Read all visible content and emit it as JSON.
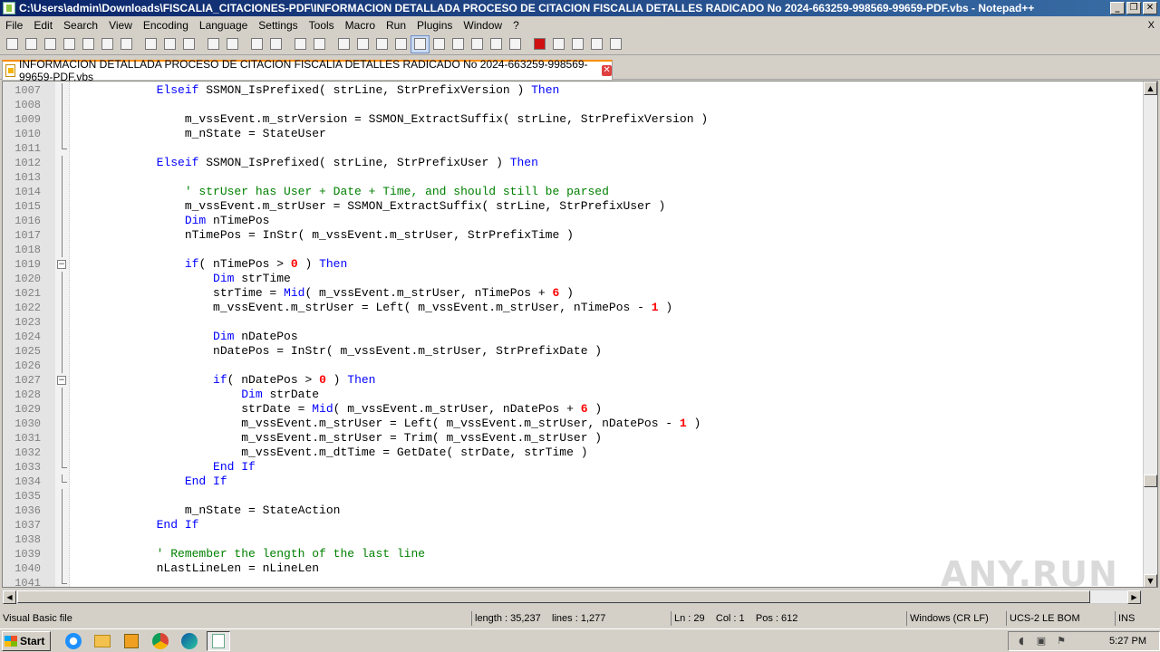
{
  "window": {
    "title": "C:\\Users\\admin\\Downloads\\FISCALIA_CITACIONES-PDF\\INFORMACION DETALLADA PROCESO DE CITACION FISCALIA DETALLES RADICADO No 2024-663259-998569-99659-PDF.vbs - Notepad++",
    "buttons": [
      "_",
      "❐",
      "✕"
    ]
  },
  "menu": {
    "items": [
      "File",
      "Edit",
      "Search",
      "View",
      "Encoding",
      "Language",
      "Settings",
      "Tools",
      "Macro",
      "Run",
      "Plugins",
      "Window",
      "?"
    ],
    "close_label": "X"
  },
  "toolbar": {
    "icons": [
      "new-file-icon",
      "open-file-icon",
      "save-icon",
      "save-all-icon",
      "close-icon",
      "close-all-icon",
      "print-icon",
      "sep",
      "cut-icon",
      "copy-icon",
      "paste-icon",
      "sep",
      "undo-icon",
      "redo-icon",
      "sep",
      "find-icon",
      "replace-icon",
      "sep",
      "zoom-in-icon",
      "zoom-out-icon",
      "sep",
      "sync-v-icon",
      "sync-h-icon",
      "word-wrap-icon",
      "show-all-chars-icon",
      "indent-guide-icon",
      "lang-icon",
      "doc-map-icon",
      "func-list-icon",
      "folder-workspace-icon",
      "monitor-icon",
      "sep",
      "record-macro-icon",
      "stop-record-icon",
      "play-macro-icon",
      "play-multiple-icon",
      "save-macro-icon"
    ]
  },
  "tab": {
    "label": "INFORMACION DETALLADA PROCESO DE CITACION FISCALIA DETALLES RADICADO No 2024-663259-998569-99659-PDF.vbs",
    "close": "✕"
  },
  "code_lines": [
    {
      "n": "1007",
      "fold": "line",
      "segs": [
        [
          "tx",
          "            "
        ],
        [
          "kw",
          "Elseif"
        ],
        [
          "tx",
          " SSMON_IsPrefixed( strLine, StrPrefixVersion ) "
        ],
        [
          "kw",
          "Then"
        ]
      ]
    },
    {
      "n": "1008",
      "fold": "line",
      "segs": []
    },
    {
      "n": "1009",
      "fold": "line",
      "segs": [
        [
          "tx",
          "                m_vssEvent.m_strVersion = SSMON_ExtractSuffix( strLine, StrPrefixVersion )"
        ]
      ]
    },
    {
      "n": "1010",
      "fold": "line",
      "segs": [
        [
          "tx",
          "                m_nState = StateUser"
        ]
      ]
    },
    {
      "n": "1011",
      "fold": "end",
      "segs": []
    },
    {
      "n": "1012",
      "fold": "line",
      "segs": [
        [
          "tx",
          "            "
        ],
        [
          "kw",
          "Elseif"
        ],
        [
          "tx",
          " SSMON_IsPrefixed( strLine, StrPrefixUser ) "
        ],
        [
          "kw",
          "Then"
        ]
      ]
    },
    {
      "n": "1013",
      "fold": "line",
      "segs": []
    },
    {
      "n": "1014",
      "fold": "line",
      "segs": [
        [
          "cm",
          "                ' strUser has User + Date + Time, and should still be parsed"
        ]
      ]
    },
    {
      "n": "1015",
      "fold": "line",
      "segs": [
        [
          "tx",
          "                m_vssEvent.m_strUser = SSMON_ExtractSuffix( strLine, StrPrefixUser )"
        ]
      ]
    },
    {
      "n": "1016",
      "fold": "line",
      "segs": [
        [
          "tx",
          "                "
        ],
        [
          "kw",
          "Dim"
        ],
        [
          "tx",
          " nTimePos"
        ]
      ]
    },
    {
      "n": "1017",
      "fold": "line",
      "segs": [
        [
          "tx",
          "                nTimePos = InStr( m_vssEvent.m_strUser, StrPrefixTime )"
        ]
      ]
    },
    {
      "n": "1018",
      "fold": "line",
      "segs": []
    },
    {
      "n": "1019",
      "fold": "box",
      "segs": [
        [
          "tx",
          "                "
        ],
        [
          "kw",
          "if"
        ],
        [
          "tx",
          "( nTimePos > "
        ],
        [
          "nm",
          "0"
        ],
        [
          "tx",
          " ) "
        ],
        [
          "kw",
          "Then"
        ]
      ]
    },
    {
      "n": "1020",
      "fold": "line",
      "segs": [
        [
          "tx",
          "                    "
        ],
        [
          "kw",
          "Dim"
        ],
        [
          "tx",
          " strTime"
        ]
      ]
    },
    {
      "n": "1021",
      "fold": "line",
      "segs": [
        [
          "tx",
          "                    strTime = "
        ],
        [
          "kw",
          "Mid"
        ],
        [
          "tx",
          "( m_vssEvent.m_strUser, nTimePos + "
        ],
        [
          "nm",
          "6"
        ],
        [
          "tx",
          " )"
        ]
      ]
    },
    {
      "n": "1022",
      "fold": "line",
      "segs": [
        [
          "tx",
          "                    m_vssEvent.m_strUser = Left( m_vssEvent.m_strUser, nTimePos - "
        ],
        [
          "nm",
          "1"
        ],
        [
          "tx",
          " )"
        ]
      ]
    },
    {
      "n": "1023",
      "fold": "line",
      "segs": []
    },
    {
      "n": "1024",
      "fold": "line",
      "segs": [
        [
          "tx",
          "                    "
        ],
        [
          "kw",
          "Dim"
        ],
        [
          "tx",
          " nDatePos"
        ]
      ]
    },
    {
      "n": "1025",
      "fold": "line",
      "segs": [
        [
          "tx",
          "                    nDatePos = InStr( m_vssEvent.m_strUser, StrPrefixDate )"
        ]
      ]
    },
    {
      "n": "1026",
      "fold": "line",
      "segs": []
    },
    {
      "n": "1027",
      "fold": "box",
      "segs": [
        [
          "tx",
          "                    "
        ],
        [
          "kw",
          "if"
        ],
        [
          "tx",
          "( nDatePos > "
        ],
        [
          "nm",
          "0"
        ],
        [
          "tx",
          " ) "
        ],
        [
          "kw",
          "Then"
        ]
      ]
    },
    {
      "n": "1028",
      "fold": "line",
      "segs": [
        [
          "tx",
          "                        "
        ],
        [
          "kw",
          "Dim"
        ],
        [
          "tx",
          " strDate"
        ]
      ]
    },
    {
      "n": "1029",
      "fold": "line",
      "segs": [
        [
          "tx",
          "                        strDate = "
        ],
        [
          "kw",
          "Mid"
        ],
        [
          "tx",
          "( m_vssEvent.m_strUser, nDatePos + "
        ],
        [
          "nm",
          "6"
        ],
        [
          "tx",
          " )"
        ]
      ]
    },
    {
      "n": "1030",
      "fold": "line",
      "segs": [
        [
          "tx",
          "                        m_vssEvent.m_strUser = Left( m_vssEvent.m_strUser, nDatePos - "
        ],
        [
          "nm",
          "1"
        ],
        [
          "tx",
          " )"
        ]
      ]
    },
    {
      "n": "1031",
      "fold": "line",
      "segs": [
        [
          "tx",
          "                        m_vssEvent.m_strUser = Trim( m_vssEvent.m_strUser )"
        ]
      ]
    },
    {
      "n": "1032",
      "fold": "line",
      "segs": [
        [
          "tx",
          "                        m_vssEvent.m_dtTime = GetDate( strDate, strTime )"
        ]
      ]
    },
    {
      "n": "1033",
      "fold": "end",
      "segs": [
        [
          "tx",
          "                    "
        ],
        [
          "kw",
          "End If"
        ]
      ]
    },
    {
      "n": "1034",
      "fold": "end",
      "segs": [
        [
          "tx",
          "                "
        ],
        [
          "kw",
          "End If"
        ]
      ]
    },
    {
      "n": "1035",
      "fold": "line",
      "segs": []
    },
    {
      "n": "1036",
      "fold": "line",
      "segs": [
        [
          "tx",
          "                m_nState = StateAction"
        ]
      ]
    },
    {
      "n": "1037",
      "fold": "line",
      "segs": [
        [
          "tx",
          "            "
        ],
        [
          "kw",
          "End If"
        ]
      ]
    },
    {
      "n": "1038",
      "fold": "line",
      "segs": []
    },
    {
      "n": "1039",
      "fold": "line",
      "segs": [
        [
          "cm",
          "            ' Remember the length of the last line"
        ]
      ]
    },
    {
      "n": "1040",
      "fold": "line",
      "segs": [
        [
          "tx",
          "            nLastLineLen = nLineLen"
        ]
      ]
    },
    {
      "n": "1041",
      "fold": "end",
      "segs": []
    }
  ],
  "statusbar": {
    "filetype": "Visual Basic file",
    "length": "length : 35,237",
    "lines": "lines : 1,277",
    "ln": "Ln : 29",
    "col": "Col : 1",
    "pos": "Pos : 612",
    "eol": "Windows (CR LF)",
    "encoding": "UCS-2 LE BOM",
    "mode": "INS"
  },
  "taskbar": {
    "start_label": "Start",
    "clock": "5:27 PM",
    "apps": [
      "ie-icon",
      "explorer-icon",
      "media-player-icon",
      "chrome-icon",
      "edge-icon",
      "notepadpp-icon"
    ]
  },
  "watermark": "ANY.RUN",
  "colors": {
    "keyword": "#0000ff",
    "comment": "#008000",
    "number": "#ff0000",
    "tab_accent": "#fa8c00",
    "title_start": "#0a246a",
    "title_end": "#3a6ea5"
  }
}
